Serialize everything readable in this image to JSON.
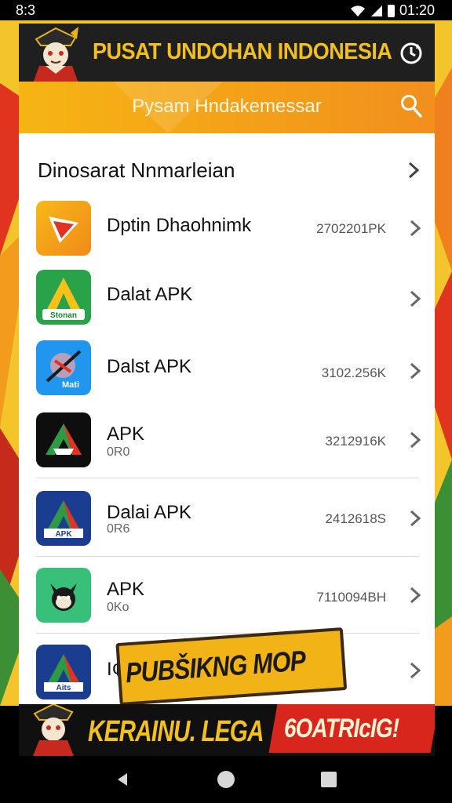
{
  "status_bar": {
    "time": "8:3",
    "clock_right": "01:20"
  },
  "header": {
    "title": "PUSAT UNDOHAN INDONESIA",
    "sync_icon": "sync-icon"
  },
  "search_bar": {
    "title": "Pysam Hndakemessar",
    "icon": "search-icon"
  },
  "section": {
    "title": "Dinosarat Nnmarleian"
  },
  "apps": [
    {
      "name": "Dptin Dhaohnimk",
      "sub": "",
      "size": "2702201PK",
      "icon": "play-store-icon"
    },
    {
      "name": "Dalat APK",
      "sub": "",
      "size": "",
      "icon": "green-a-icon",
      "icon_label": "Stonan"
    },
    {
      "name": "Dalst APK",
      "sub": "",
      "size": "3102.256K",
      "icon": "blue-compass-icon",
      "icon_label": "Mati"
    },
    {
      "name": "APK",
      "sub": "0R0",
      "size": "3212916K",
      "icon": "black-a-icon"
    },
    {
      "name": "Dalai APK",
      "sub": "0R6",
      "size": "2412618S",
      "icon": "navy-a-icon",
      "icon_label": "APK"
    },
    {
      "name": "APK",
      "sub": "0Ko",
      "size": "7110094BH",
      "icon": "cat-icon"
    },
    {
      "name": "I¢",
      "sub": "",
      "size": "",
      "icon": "navy-a-icon",
      "icon_label": "Aits"
    }
  ],
  "promo": {
    "label": "PUBŠIKNG MOP"
  },
  "banner": {
    "text": "KERAINU. LEGA",
    "cta": "6OATRIcIG!"
  },
  "colors": {
    "accent_yellow": "#f2c01d",
    "accent_orange": "#f28f1d",
    "cta_red": "#d9261c",
    "header_dark": "#1f1f1f"
  }
}
